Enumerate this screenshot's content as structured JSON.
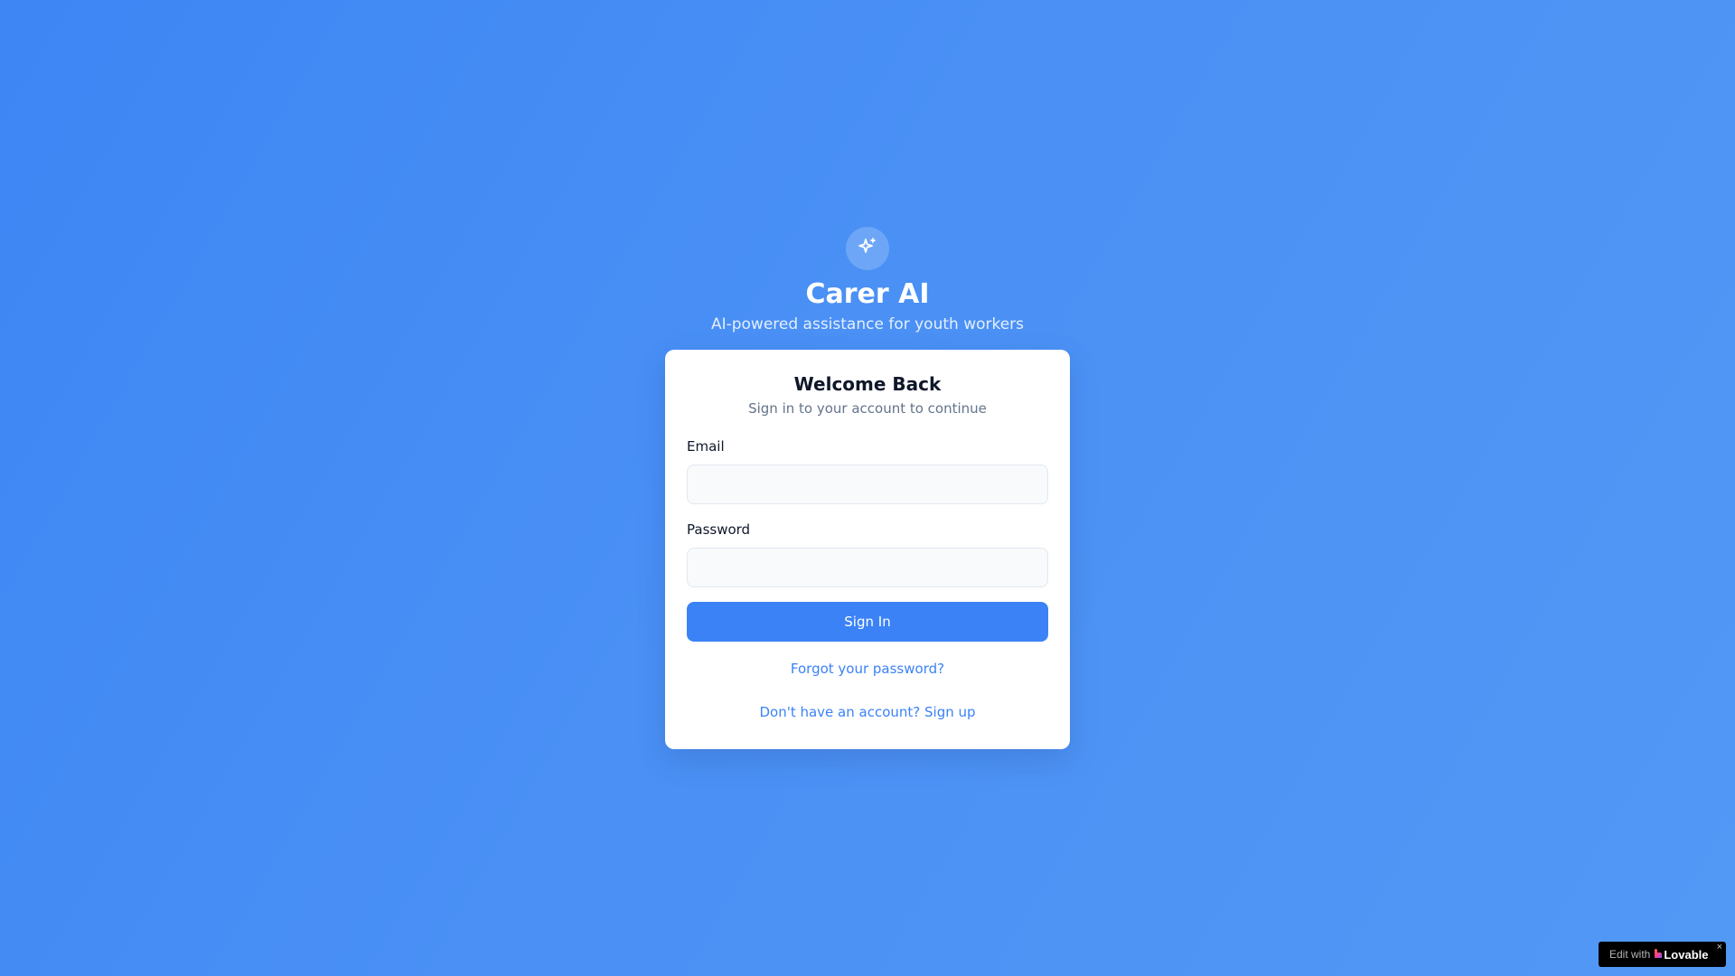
{
  "brand": {
    "icon": "sparkles-icon",
    "title": "Carer AI",
    "subtitle": "AI-powered assistance for youth workers"
  },
  "login_card": {
    "title": "Welcome Back",
    "subtitle": "Sign in to your account to continue",
    "email_label": "Email",
    "email_value": "",
    "password_label": "Password",
    "password_value": "",
    "submit_label": "Sign In",
    "forgot_label": "Forgot your password?",
    "signup_label": "Don't have an account? Sign up"
  },
  "badge": {
    "edit_label": "Edit with",
    "brand_name": "Lovable",
    "close_symbol": "×",
    "heart_icon": "lovable-heart-icon"
  },
  "colors": {
    "background": "#4a90f5",
    "accent": "#3b82f6",
    "card": "#ffffff",
    "heading": "#0f172a",
    "muted": "#64748b"
  }
}
